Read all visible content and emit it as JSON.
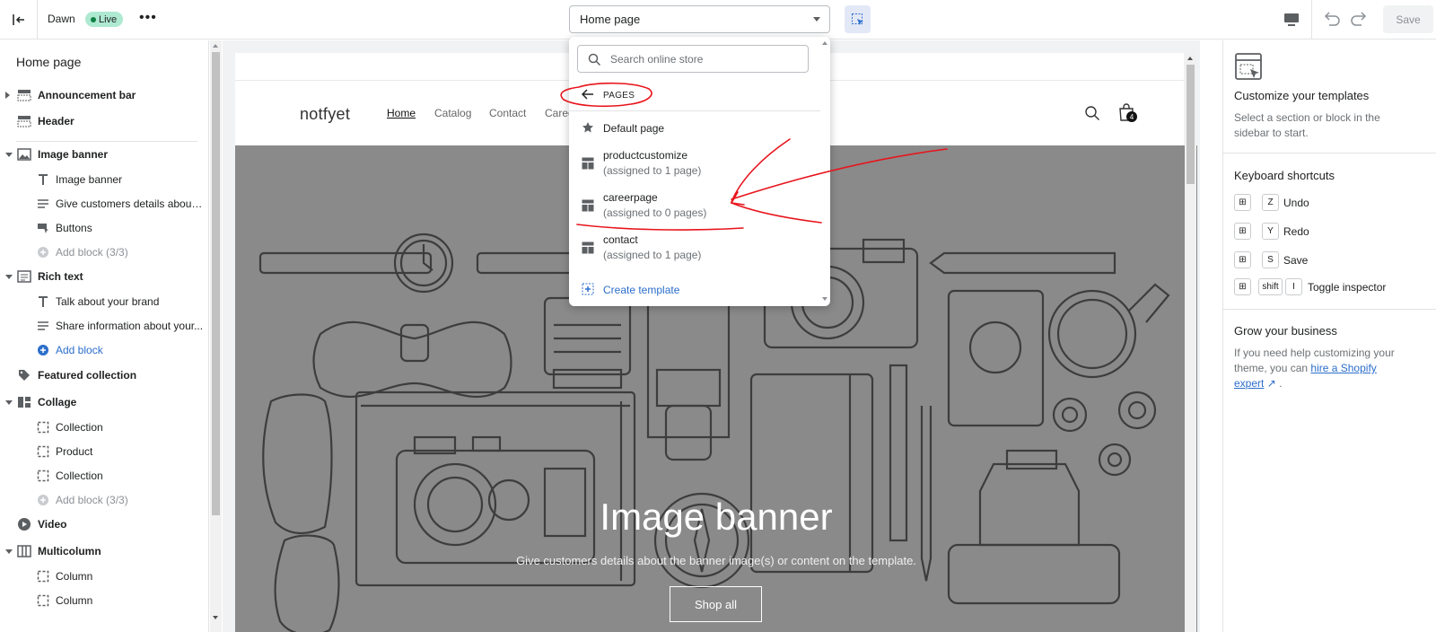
{
  "topbar": {
    "theme_name": "Dawn",
    "live_label": "Live",
    "template_select": "Home page",
    "save_label": "Save"
  },
  "sidebar": {
    "title": "Home page",
    "rows": [
      {
        "label": "Announcement bar",
        "icon": "announcement-icon"
      },
      {
        "label": "Header",
        "icon": "header-icon"
      },
      {
        "label": "Image banner",
        "icon": "image-icon"
      },
      {
        "label": "Image banner",
        "icon": "text-icon"
      },
      {
        "label": "Give customers details about ...",
        "icon": "paragraph-icon"
      },
      {
        "label": "Buttons",
        "icon": "buttons-icon"
      },
      {
        "label": "Add block (3/3)",
        "icon": "add-circle-icon"
      },
      {
        "label": "Rich text",
        "icon": "rich-text-icon"
      },
      {
        "label": "Talk about your brand",
        "icon": "text-icon"
      },
      {
        "label": "Share information about your...",
        "icon": "paragraph-icon"
      },
      {
        "label": "Add block",
        "icon": "add-circle-icon"
      },
      {
        "label": "Featured collection",
        "icon": "tag-icon"
      },
      {
        "label": "Collage",
        "icon": "collage-icon"
      },
      {
        "label": "Collection",
        "icon": "dashed-box-icon"
      },
      {
        "label": "Product",
        "icon": "dashed-box-icon"
      },
      {
        "label": "Collection",
        "icon": "dashed-box-icon"
      },
      {
        "label": "Add block (3/3)",
        "icon": "add-circle-icon"
      },
      {
        "label": "Video",
        "icon": "play-icon"
      },
      {
        "label": "Multicolumn",
        "icon": "columns-icon"
      },
      {
        "label": "Column",
        "icon": "dashed-box-icon"
      },
      {
        "label": "Column",
        "icon": "dashed-box-icon"
      }
    ]
  },
  "dropdown": {
    "search_placeholder": "Search online store",
    "section": "PAGES",
    "items": [
      {
        "title": "Default page",
        "sub": ""
      },
      {
        "title": "productcustomize",
        "sub": "(assigned to 1 page)"
      },
      {
        "title": "careerpage",
        "sub": "(assigned to 0 pages)"
      },
      {
        "title": "contact",
        "sub": "(assigned to 1 page)"
      }
    ],
    "create_label": "Create template"
  },
  "preview": {
    "logo": "notfyet",
    "nav": [
      "Home",
      "Catalog",
      "Contact",
      "Caree"
    ],
    "cart_count": "4",
    "banner_title": "Image banner",
    "banner_sub": "Give customers details about the banner image(s) or content on the template.",
    "banner_button": "Shop all"
  },
  "rightpanel": {
    "customize_title": "Customize your templates",
    "customize_text": "Select a section or block in the sidebar to start.",
    "shortcuts_title": "Keyboard shortcuts",
    "shortcuts": [
      {
        "keys": [
          "⊞",
          "Z"
        ],
        "label": "Undo"
      },
      {
        "keys": [
          "⊞",
          "Y"
        ],
        "label": "Redo"
      },
      {
        "keys": [
          "⊞",
          "S"
        ],
        "label": "Save"
      },
      {
        "keys": [
          "⊞",
          "shift",
          "I"
        ],
        "label": "Toggle inspector"
      }
    ],
    "grow_title": "Grow your business",
    "grow_text": "If you need help customizing your theme, you can",
    "grow_link": "hire a Shopify expert",
    "grow_end": "."
  },
  "colors": {
    "accent": "#2c6ecb",
    "live_badge": "#aee9d1",
    "banner_bg": "#8a8a8a",
    "annotation": "#e8141b"
  }
}
